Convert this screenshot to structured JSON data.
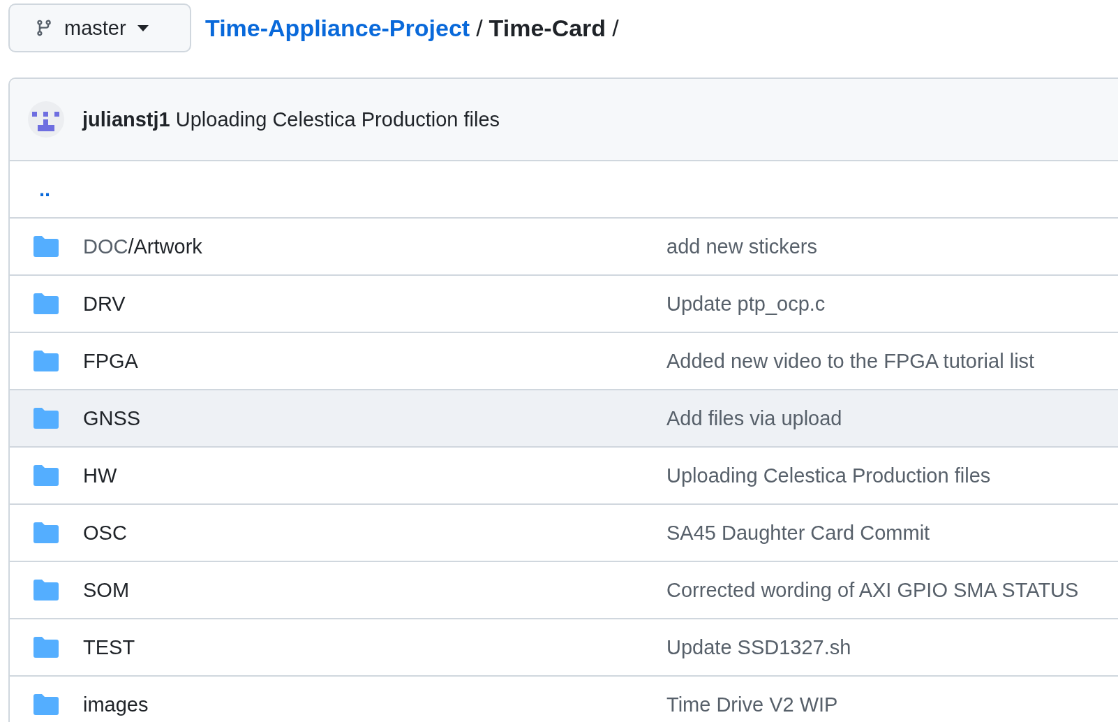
{
  "branch_button": {
    "label": "master"
  },
  "breadcrumb": {
    "repo": "Time-Appliance-Project",
    "separator_1": "/",
    "folder": "Time-Card",
    "separator_2": "/"
  },
  "latest_commit": {
    "author": "julianstj1",
    "message": "Uploading Celestica Production files"
  },
  "parent_link": "..",
  "rows": [
    {
      "prefix": "DOC",
      "name": "/Artwork",
      "message": "add new stickers",
      "highlighted": false
    },
    {
      "name": "DRV",
      "message": "Update ptp_ocp.c",
      "highlighted": false
    },
    {
      "name": "FPGA",
      "message": "Added new video to the FPGA tutorial list",
      "highlighted": false
    },
    {
      "name": "GNSS",
      "message": "Add files via upload",
      "highlighted": true
    },
    {
      "name": "HW",
      "message": "Uploading Celestica Production files",
      "highlighted": false
    },
    {
      "name": "OSC",
      "message": "SA45 Daughter Card Commit",
      "highlighted": false
    },
    {
      "name": "SOM",
      "message": "Corrected wording of AXI GPIO SMA STATUS",
      "highlighted": false
    },
    {
      "name": "TEST",
      "message": "Update SSD1327.sh",
      "highlighted": false
    },
    {
      "name": "images",
      "message": "Time Drive V2 WIP",
      "highlighted": false
    }
  ]
}
